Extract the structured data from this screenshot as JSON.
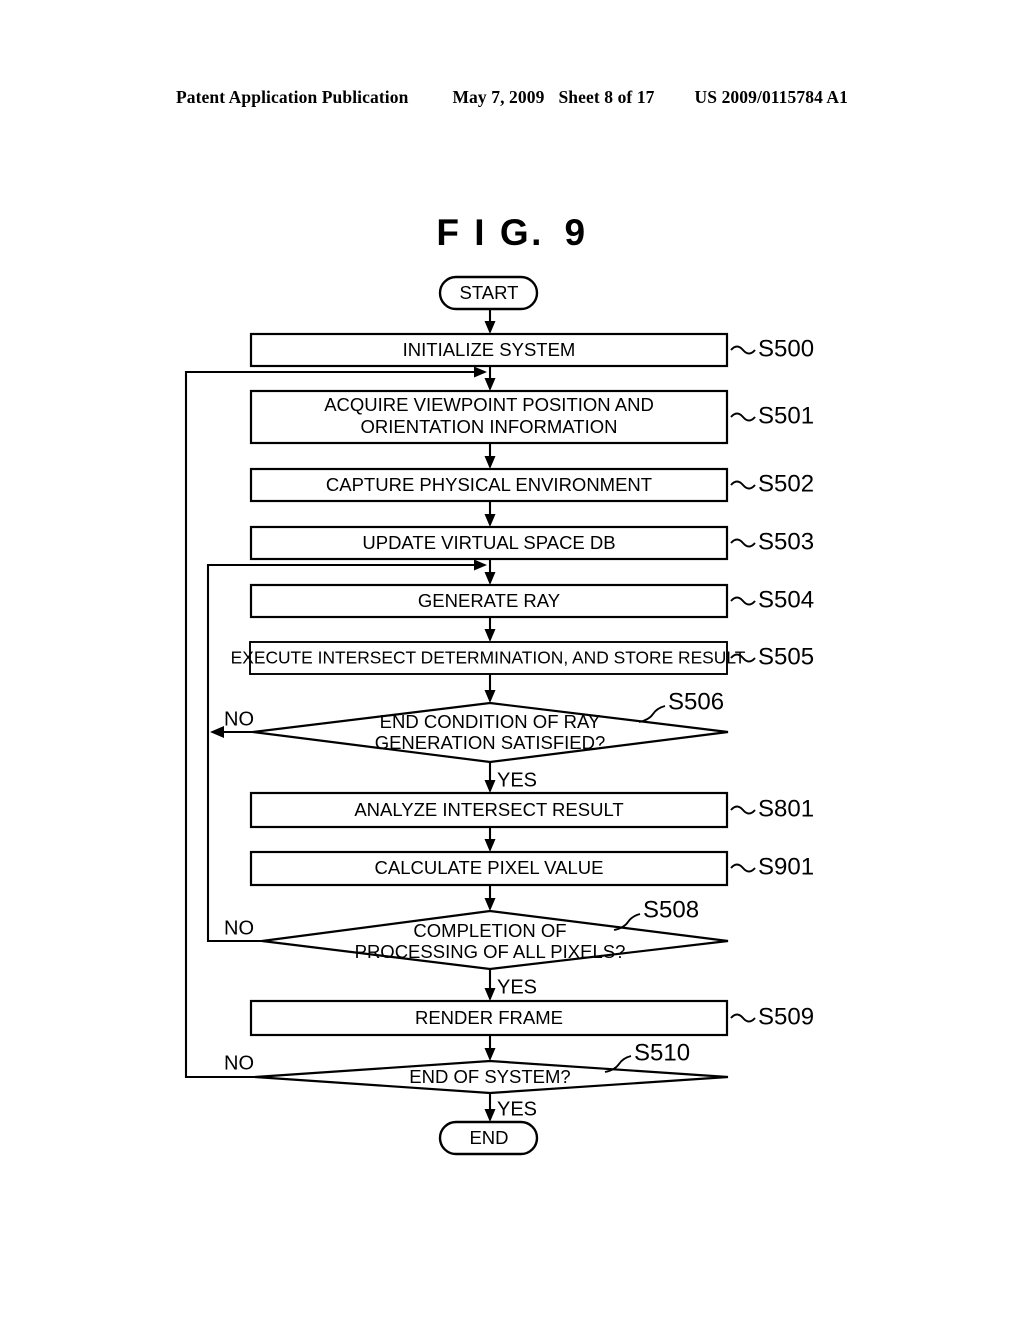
{
  "header": {
    "publication": "Patent Application Publication",
    "date": "May 7, 2009",
    "sheet": "Sheet 8 of 17",
    "patent_number": "US 2009/0115784 A1"
  },
  "figure": {
    "title_part1": "F I G.",
    "title_part2": "9"
  },
  "chart_data": {
    "type": "diagram",
    "diagram_type": "flowchart",
    "title": "FIG. 9",
    "orientation": "top-to-bottom",
    "nodes": [
      {
        "id": "start",
        "shape": "terminator",
        "label": "START",
        "step": ""
      },
      {
        "id": "S500",
        "shape": "process",
        "label": "INITIALIZE SYSTEM",
        "step": "S500"
      },
      {
        "id": "S501",
        "shape": "process",
        "label_line1": "ACQUIRE VIEWPOINT POSITION AND",
        "label_line2": "ORIENTATION INFORMATION",
        "step": "S501"
      },
      {
        "id": "S502",
        "shape": "process",
        "label": "CAPTURE PHYSICAL ENVIRONMENT",
        "step": "S502"
      },
      {
        "id": "S503",
        "shape": "process",
        "label": "UPDATE VIRTUAL SPACE DB",
        "step": "S503"
      },
      {
        "id": "S504",
        "shape": "process",
        "label": "GENERATE RAY",
        "step": "S504"
      },
      {
        "id": "S505",
        "shape": "process",
        "label": "EXECUTE INTERSECT DETERMINATION, AND STORE RESULT",
        "step": "S505"
      },
      {
        "id": "S506",
        "shape": "decision",
        "label_line1": "END CONDITION OF RAY",
        "label_line2": "GENERATION SATISFIED?",
        "step": "S506",
        "yes": "YES",
        "no": "NO"
      },
      {
        "id": "S801",
        "shape": "process",
        "label": "ANALYZE INTERSECT RESULT",
        "step": "S801"
      },
      {
        "id": "S901",
        "shape": "process",
        "label": "CALCULATE PIXEL VALUE",
        "step": "S901"
      },
      {
        "id": "S508",
        "shape": "decision",
        "label_line1": "COMPLETION OF",
        "label_line2": "PROCESSING OF ALL PIXELS?",
        "step": "S508",
        "yes": "YES",
        "no": "NO"
      },
      {
        "id": "S509",
        "shape": "process",
        "label": "RENDER FRAME",
        "step": "S509"
      },
      {
        "id": "S510",
        "shape": "decision",
        "label": "END OF SYSTEM?",
        "step": "S510",
        "yes": "YES",
        "no": "NO"
      },
      {
        "id": "end",
        "shape": "terminator",
        "label": "END",
        "step": ""
      }
    ],
    "edges": [
      {
        "from": "start",
        "to": "S500",
        "label": ""
      },
      {
        "from": "S500",
        "to": "S501",
        "label": ""
      },
      {
        "from": "S501",
        "to": "S502",
        "label": ""
      },
      {
        "from": "S502",
        "to": "S503",
        "label": ""
      },
      {
        "from": "S503",
        "to": "S504",
        "label": ""
      },
      {
        "from": "S504",
        "to": "S505",
        "label": ""
      },
      {
        "from": "S505",
        "to": "S506",
        "label": ""
      },
      {
        "from": "S506",
        "to": "S801",
        "label": "YES"
      },
      {
        "from": "S506",
        "to": "S504",
        "label": "NO"
      },
      {
        "from": "S801",
        "to": "S901",
        "label": ""
      },
      {
        "from": "S901",
        "to": "S508",
        "label": ""
      },
      {
        "from": "S508",
        "to": "S509",
        "label": "YES"
      },
      {
        "from": "S508",
        "to": "S504",
        "label": "NO"
      },
      {
        "from": "S509",
        "to": "S510",
        "label": ""
      },
      {
        "from": "S510",
        "to": "end",
        "label": "YES"
      },
      {
        "from": "S510",
        "to": "S501",
        "label": "NO"
      }
    ],
    "colors": {
      "stroke": "#000000",
      "fill": "#ffffff",
      "background": "#ffffff"
    }
  },
  "branch_labels": {
    "s506_no": "NO",
    "s506_yes": "YES",
    "s508_no": "NO",
    "s508_yes": "YES",
    "s510_no": "NO",
    "s510_yes": "YES"
  }
}
